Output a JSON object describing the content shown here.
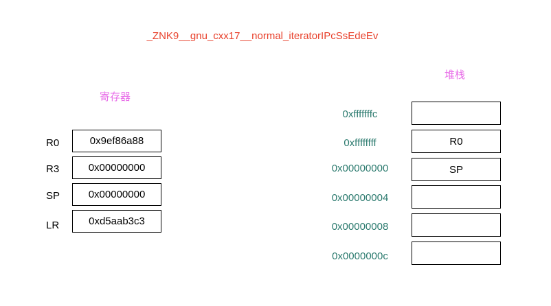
{
  "title": "_ZNK9__gnu_cxx17__normal_iteratorIPcSsEdeEv",
  "registers": {
    "label": "寄存器",
    "items": [
      {
        "name": "R0",
        "value": "0x9ef86a88"
      },
      {
        "name": "R3",
        "value": "0x00000000"
      },
      {
        "name": "SP",
        "value": "0x00000000"
      },
      {
        "name": "LR",
        "value": "0xd5aab3c3"
      }
    ]
  },
  "stack": {
    "label": "堆栈",
    "items": [
      {
        "address": "0xfffffffc",
        "value": ""
      },
      {
        "address": "0xffffffff",
        "value": "R0"
      },
      {
        "address": "0x00000000",
        "value": "SP"
      },
      {
        "address": "0x00000004",
        "value": ""
      },
      {
        "address": "0x00000008",
        "value": ""
      },
      {
        "address": "0x0000000c",
        "value": ""
      }
    ]
  },
  "colors": {
    "title": "#e8412c",
    "section_label": "#e86ee8",
    "address": "#2b7a6e",
    "text": "#000000"
  }
}
